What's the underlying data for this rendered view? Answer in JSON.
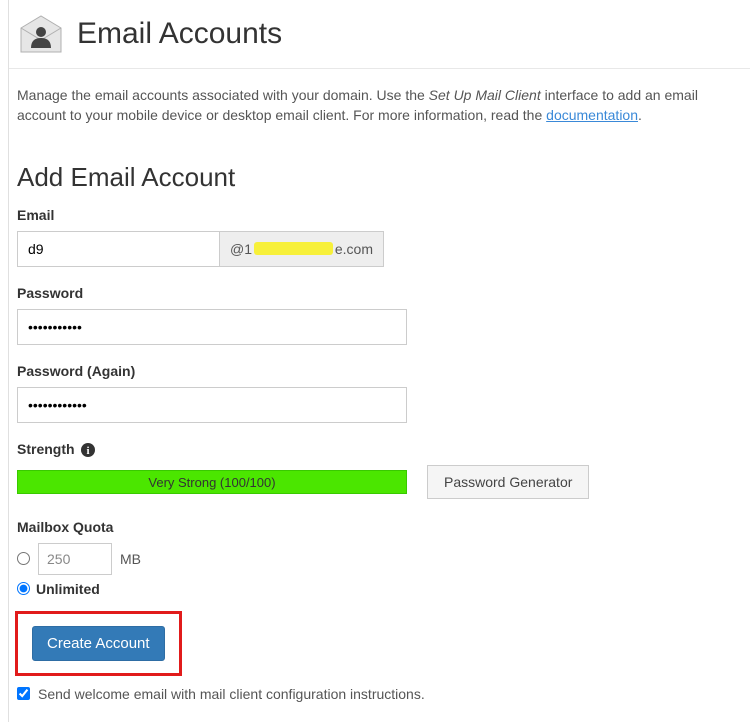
{
  "header": {
    "title": "Email Accounts"
  },
  "description": {
    "part1": "Manage the email accounts associated with your domain. Use the ",
    "em": "Set Up Mail Client",
    "part2": " interface to add an email account to your mobile device or desktop email client. For more information, read the ",
    "link": "documentation",
    "part3": "."
  },
  "section": {
    "title": "Add Email Account"
  },
  "fields": {
    "email": {
      "label": "Email",
      "value": "d9",
      "domain_prefix": "@1",
      "domain_suffix": "e.com"
    },
    "password": {
      "label": "Password",
      "value": "•••••••••••"
    },
    "password_again": {
      "label": "Password (Again)",
      "value": "••••••••••••"
    },
    "strength": {
      "label": "Strength",
      "text": "Very Strong (100/100)"
    },
    "pwgen": {
      "label": "Password Generator"
    },
    "quota": {
      "label": "Mailbox Quota",
      "value": "250",
      "unit": "MB",
      "unlimited_label": "Unlimited"
    },
    "create": {
      "label": "Create Account"
    },
    "welcome": {
      "label": "Send welcome email with mail client configuration instructions."
    }
  }
}
